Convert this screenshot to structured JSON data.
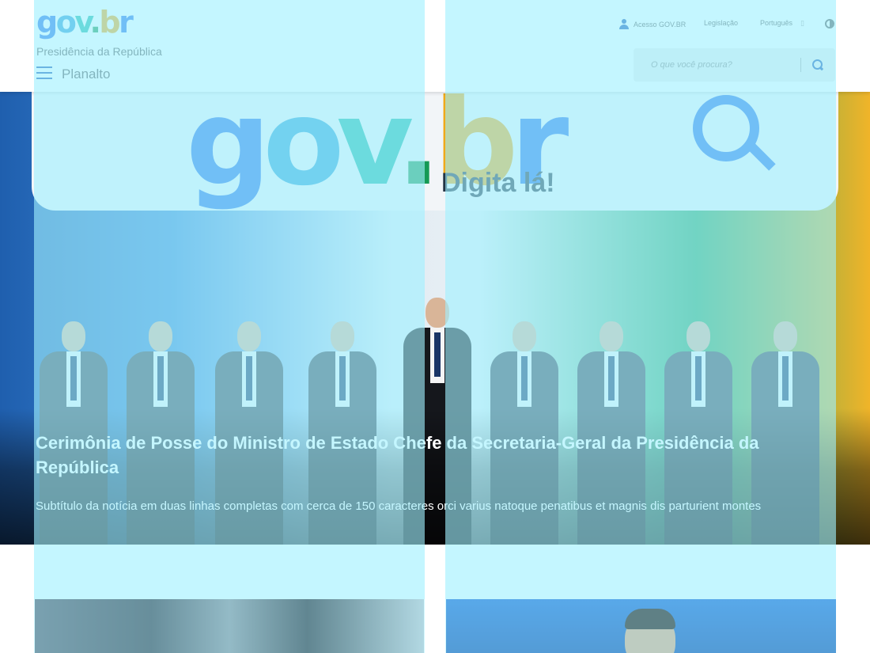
{
  "header": {
    "logo": {
      "g": "g",
      "o": "o",
      "v": "v",
      "dot": ".",
      "b": "b",
      "r": "r"
    },
    "subtitle": "Presidência da República",
    "site_name": "Planalto",
    "login_label": "Acesso GOV.BR",
    "legislation_label": "Legislação",
    "language_label": "Português",
    "language_caret": "▯",
    "search": {
      "placeholder": "O que você procura?"
    }
  },
  "hero": {
    "banner_tagline": "Digita lá!",
    "title": "Cerimônia de Posse do Ministro de Estado Chefe da Secretaria-Geral da Presidência da República",
    "subtitle": "Subtítulo da notícia em duas linhas completas com cerca de 150 caracteres orci varius natoque penatibus et magnis dis parturient montes"
  },
  "colors": {
    "brand_blue": "#1351b4",
    "grid_overlay": "#a0f0ff",
    "logo_blue": "#2670e8",
    "logo_green": "#159a55",
    "logo_yellow": "#f0a818"
  }
}
